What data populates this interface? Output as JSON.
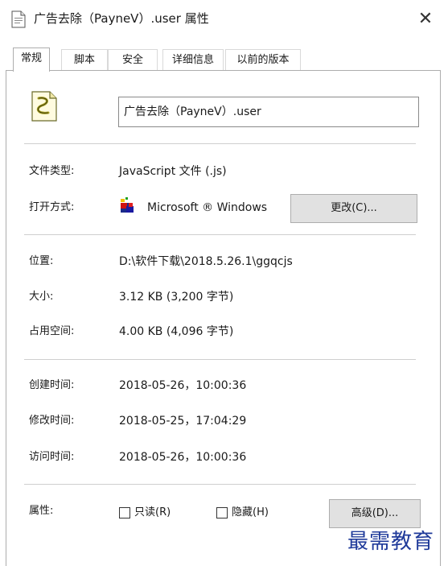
{
  "window": {
    "title": "广告去除（PayneV）.user 属性",
    "close_glyph": "✕"
  },
  "tabs": [
    {
      "label": "常规",
      "active": true
    },
    {
      "label": "脚本",
      "active": false
    },
    {
      "label": "安全",
      "active": false
    },
    {
      "label": "详细信息",
      "active": false
    },
    {
      "label": "以前的版本",
      "active": false
    }
  ],
  "file": {
    "icon": "script-file-icon",
    "name": "广告去除（PayneV）.user"
  },
  "details": {
    "type_label": "文件类型:",
    "type_value": "JavaScript 文件 (.js)",
    "open_with_label": "打开方式:",
    "open_with_value": "Microsoft ® Windows",
    "open_with_icon": "windows-script-host-icon",
    "change_button": "更改(C)...",
    "location_label": "位置:",
    "location_value": "D:\\软件下载\\2018.5.26.1\\ggqcjs",
    "size_label": "大小:",
    "size_value": "3.12 KB (3,200 字节)",
    "disk_size_label": "占用空间:",
    "disk_size_value": "4.00 KB (4,096 字节)",
    "created_label": "创建时间:",
    "created_value": "2018-05-26，10:00:36",
    "modified_label": "修改时间:",
    "modified_value": "2018-05-25，17:04:29",
    "accessed_label": "访问时间:",
    "accessed_value": "2018-05-26，10:00:36",
    "attributes_label": "属性:",
    "readonly_label": "只读(R)",
    "readonly_checked": false,
    "hidden_label": "隐藏(H)",
    "hidden_checked": false,
    "advanced_button": "高级(D)..."
  },
  "watermark": "最需教育",
  "colors": {
    "watermark": "#1f3a9a",
    "button_bg": "#e1e1e1",
    "separator": "#cfcfcf"
  }
}
